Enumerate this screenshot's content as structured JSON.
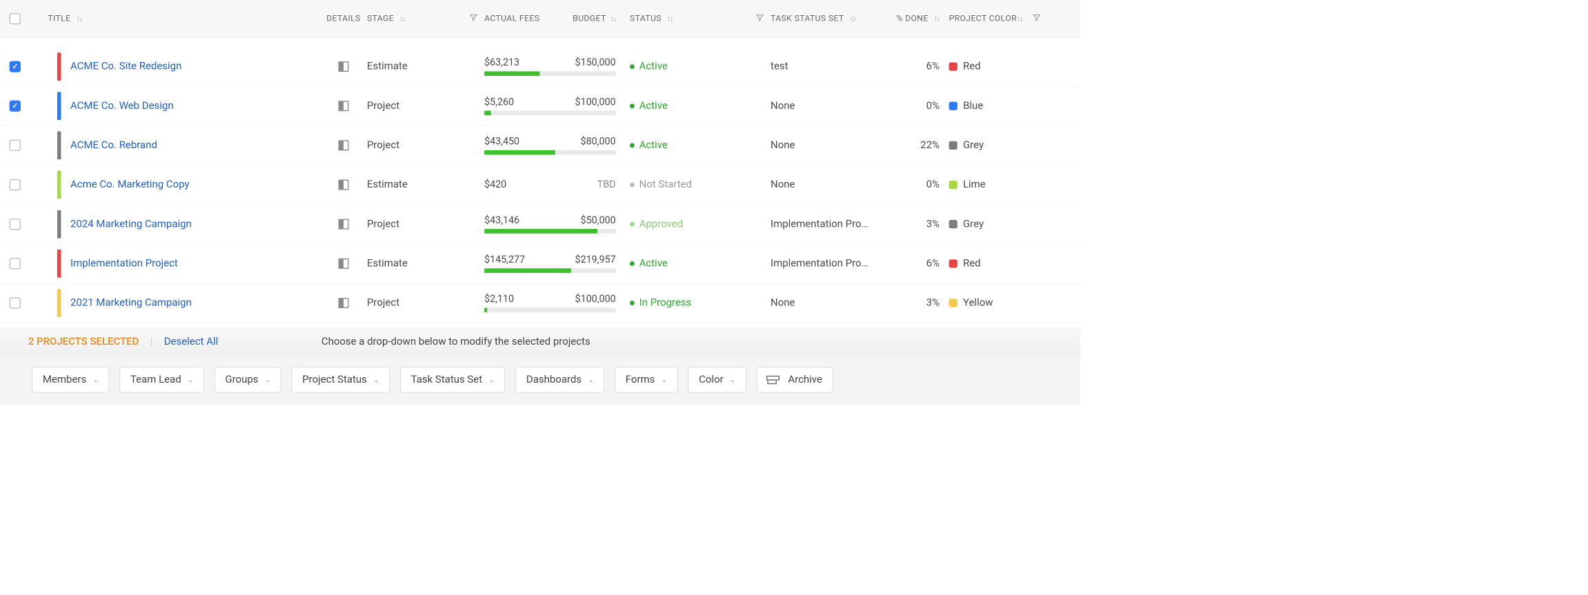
{
  "columns": {
    "title": "TITLE",
    "details": "DETAILS",
    "stage": "STAGE",
    "actual_fees": "ACTUAL FEES",
    "budget": "BUDGET",
    "status": "STATUS",
    "task_status_set": "TASK STATUS SET",
    "pct_done": "% DONE",
    "project_color": "PROJECT COLOR"
  },
  "rows": [
    {
      "checked": true,
      "stripe_color": "#e64545",
      "title": "ACME Co. Site Redesign",
      "stage": "Estimate",
      "fees": "$63,213",
      "budget": "$150,000",
      "budget_pct": 42,
      "status_text": "Active",
      "status_color": "#2fa82f",
      "status_text_color": "#2fa82f",
      "task_status_set": "test",
      "pct_done": "6%",
      "color_swatch": "#e64545",
      "color_label": "Red"
    },
    {
      "checked": true,
      "stripe_color": "#2d7af4",
      "title": "ACME Co. Web Design",
      "stage": "Project",
      "fees": "$5,260",
      "budget": "$100,000",
      "budget_pct": 5,
      "status_text": "Active",
      "status_color": "#2fa82f",
      "status_text_color": "#2fa82f",
      "task_status_set": "None",
      "pct_done": "0%",
      "color_swatch": "#2d7af4",
      "color_label": "Blue"
    },
    {
      "checked": false,
      "stripe_color": "#7d7d7d",
      "title": "ACME Co. Rebrand",
      "stage": "Project",
      "fees": "$43,450",
      "budget": "$80,000",
      "budget_pct": 54,
      "status_text": "Active",
      "status_color": "#2fa82f",
      "status_text_color": "#2fa82f",
      "task_status_set": "None",
      "pct_done": "22%",
      "color_swatch": "#7d7d7d",
      "color_label": "Grey"
    },
    {
      "checked": false,
      "stripe_color": "#a6d943",
      "title": "Acme Co. Marketing Copy",
      "stage": "Estimate",
      "fees": "$420",
      "budget": "TBD",
      "budget_pct": null,
      "status_text": "Not Started",
      "status_color": "#bdbdbd",
      "status_text_color": "#9a9a9a",
      "task_status_set": "None",
      "pct_done": "0%",
      "color_swatch": "#a6d943",
      "color_label": "Lime"
    },
    {
      "checked": false,
      "stripe_color": "#7d7d7d",
      "title": "2024 Marketing Campaign",
      "stage": "Project",
      "fees": "$43,146",
      "budget": "$50,000",
      "budget_pct": 86,
      "status_text": "Approved",
      "status_color": "#9fdc8f",
      "status_text_color": "#8acb78",
      "task_status_set": "Implementation Pro…",
      "pct_done": "3%",
      "color_swatch": "#7d7d7d",
      "color_label": "Grey"
    },
    {
      "checked": false,
      "stripe_color": "#e64545",
      "title": "Implementation Project",
      "stage": "Estimate",
      "fees": "$145,277",
      "budget": "$219,957",
      "budget_pct": 66,
      "status_text": "Active",
      "status_color": "#2fa82f",
      "status_text_color": "#2fa82f",
      "task_status_set": "Implementation Pro…",
      "pct_done": "6%",
      "color_swatch": "#e64545",
      "color_label": "Red"
    },
    {
      "checked": false,
      "stripe_color": "#f2c94c",
      "title": "2021 Marketing Campaign",
      "stage": "Project",
      "fees": "$2,110",
      "budget": "$100,000",
      "budget_pct": 2,
      "status_text": "In Progress",
      "status_color": "#2fa82f",
      "status_text_color": "#2fa82f",
      "task_status_set": "None",
      "pct_done": "3%",
      "color_swatch": "#f2c94c",
      "color_label": "Yellow"
    }
  ],
  "footer": {
    "selected_text": "2 PROJECTS SELECTED",
    "deselect": "Deselect All",
    "hint": "Choose a drop-down below to modify the selected projects",
    "actions": {
      "members": "Members",
      "team_lead": "Team Lead",
      "groups": "Groups",
      "project_status": "Project Status",
      "task_status_set": "Task Status Set",
      "dashboards": "Dashboards",
      "forms": "Forms",
      "color": "Color",
      "archive": "Archive"
    }
  }
}
